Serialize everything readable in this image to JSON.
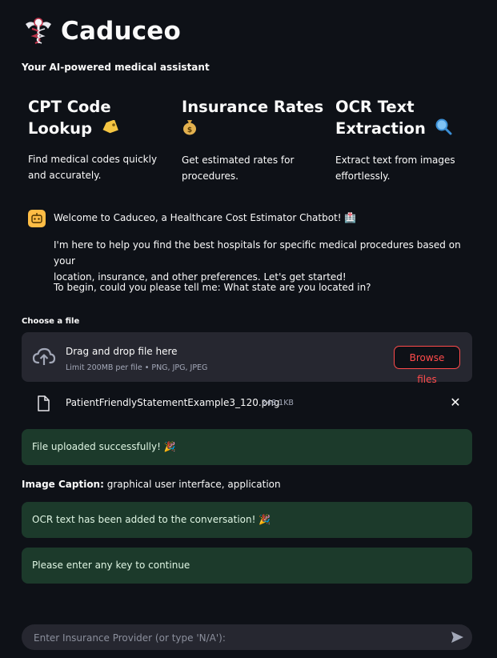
{
  "header": {
    "title": "Caduceo",
    "tagline": "Your AI-powered medical assistant",
    "logo_icon": "caduceus-logo-icon"
  },
  "features": [
    {
      "title_line1": "CPT Code",
      "title_line2": "Lookup",
      "emoji": "🏷️",
      "icon": "tag-icon",
      "desc_line1": "Find medical codes quickly",
      "desc_line2": "and accurately."
    },
    {
      "title_line1": "Insurance Rates",
      "title_line2": "",
      "emoji": "💰",
      "icon": "money-bag-icon",
      "desc_line1": "Get estimated rates for",
      "desc_line2": "procedures."
    },
    {
      "title_line1": "OCR Text",
      "title_line2": "Extraction",
      "emoji": "🔍",
      "icon": "magnifier-icon",
      "desc_line1": "Extract text from images",
      "desc_line2": "effortlessly."
    }
  ],
  "chat": {
    "welcome": "Welcome to Caduceo, a Healthcare Cost Estimator Chatbot! 🏥",
    "intro_line1": "I'm here to help you find the best hospitals for specific medical procedures based on your",
    "intro_line2": "location, insurance, and other preferences. Let's get started!",
    "question": "To begin, could you please tell me: What state are you located in?",
    "avatar_icon": "bot-avatar-icon"
  },
  "uploader": {
    "label": "Choose a file",
    "drop_title": "Drag and drop file here",
    "drop_limit": "Limit 200MB per file • PNG, JPG, JPEG",
    "browse_label": "Browse files",
    "file_name": "PatientFriendlyStatementExample3_120.png",
    "file_size": "248.1KB",
    "remove_label": "✕"
  },
  "status": {
    "upload_success": "File uploaded successfully! 🎉",
    "caption_label": "Image Caption:",
    "caption_value": " graphical user interface, application",
    "ocr_added": "OCR text has been added to the conversation! 🎉",
    "continue_prompt": "Please enter any key to continue"
  },
  "input": {
    "placeholder": "Enter Insurance Provider (or type 'N/A'):",
    "send_icon": "send-icon"
  },
  "colors": {
    "background": "#0e1117",
    "panel": "#262730",
    "accent": "#ff4b4b",
    "success_bg": "#1c3a2b",
    "avatar": "#ffbd45"
  }
}
